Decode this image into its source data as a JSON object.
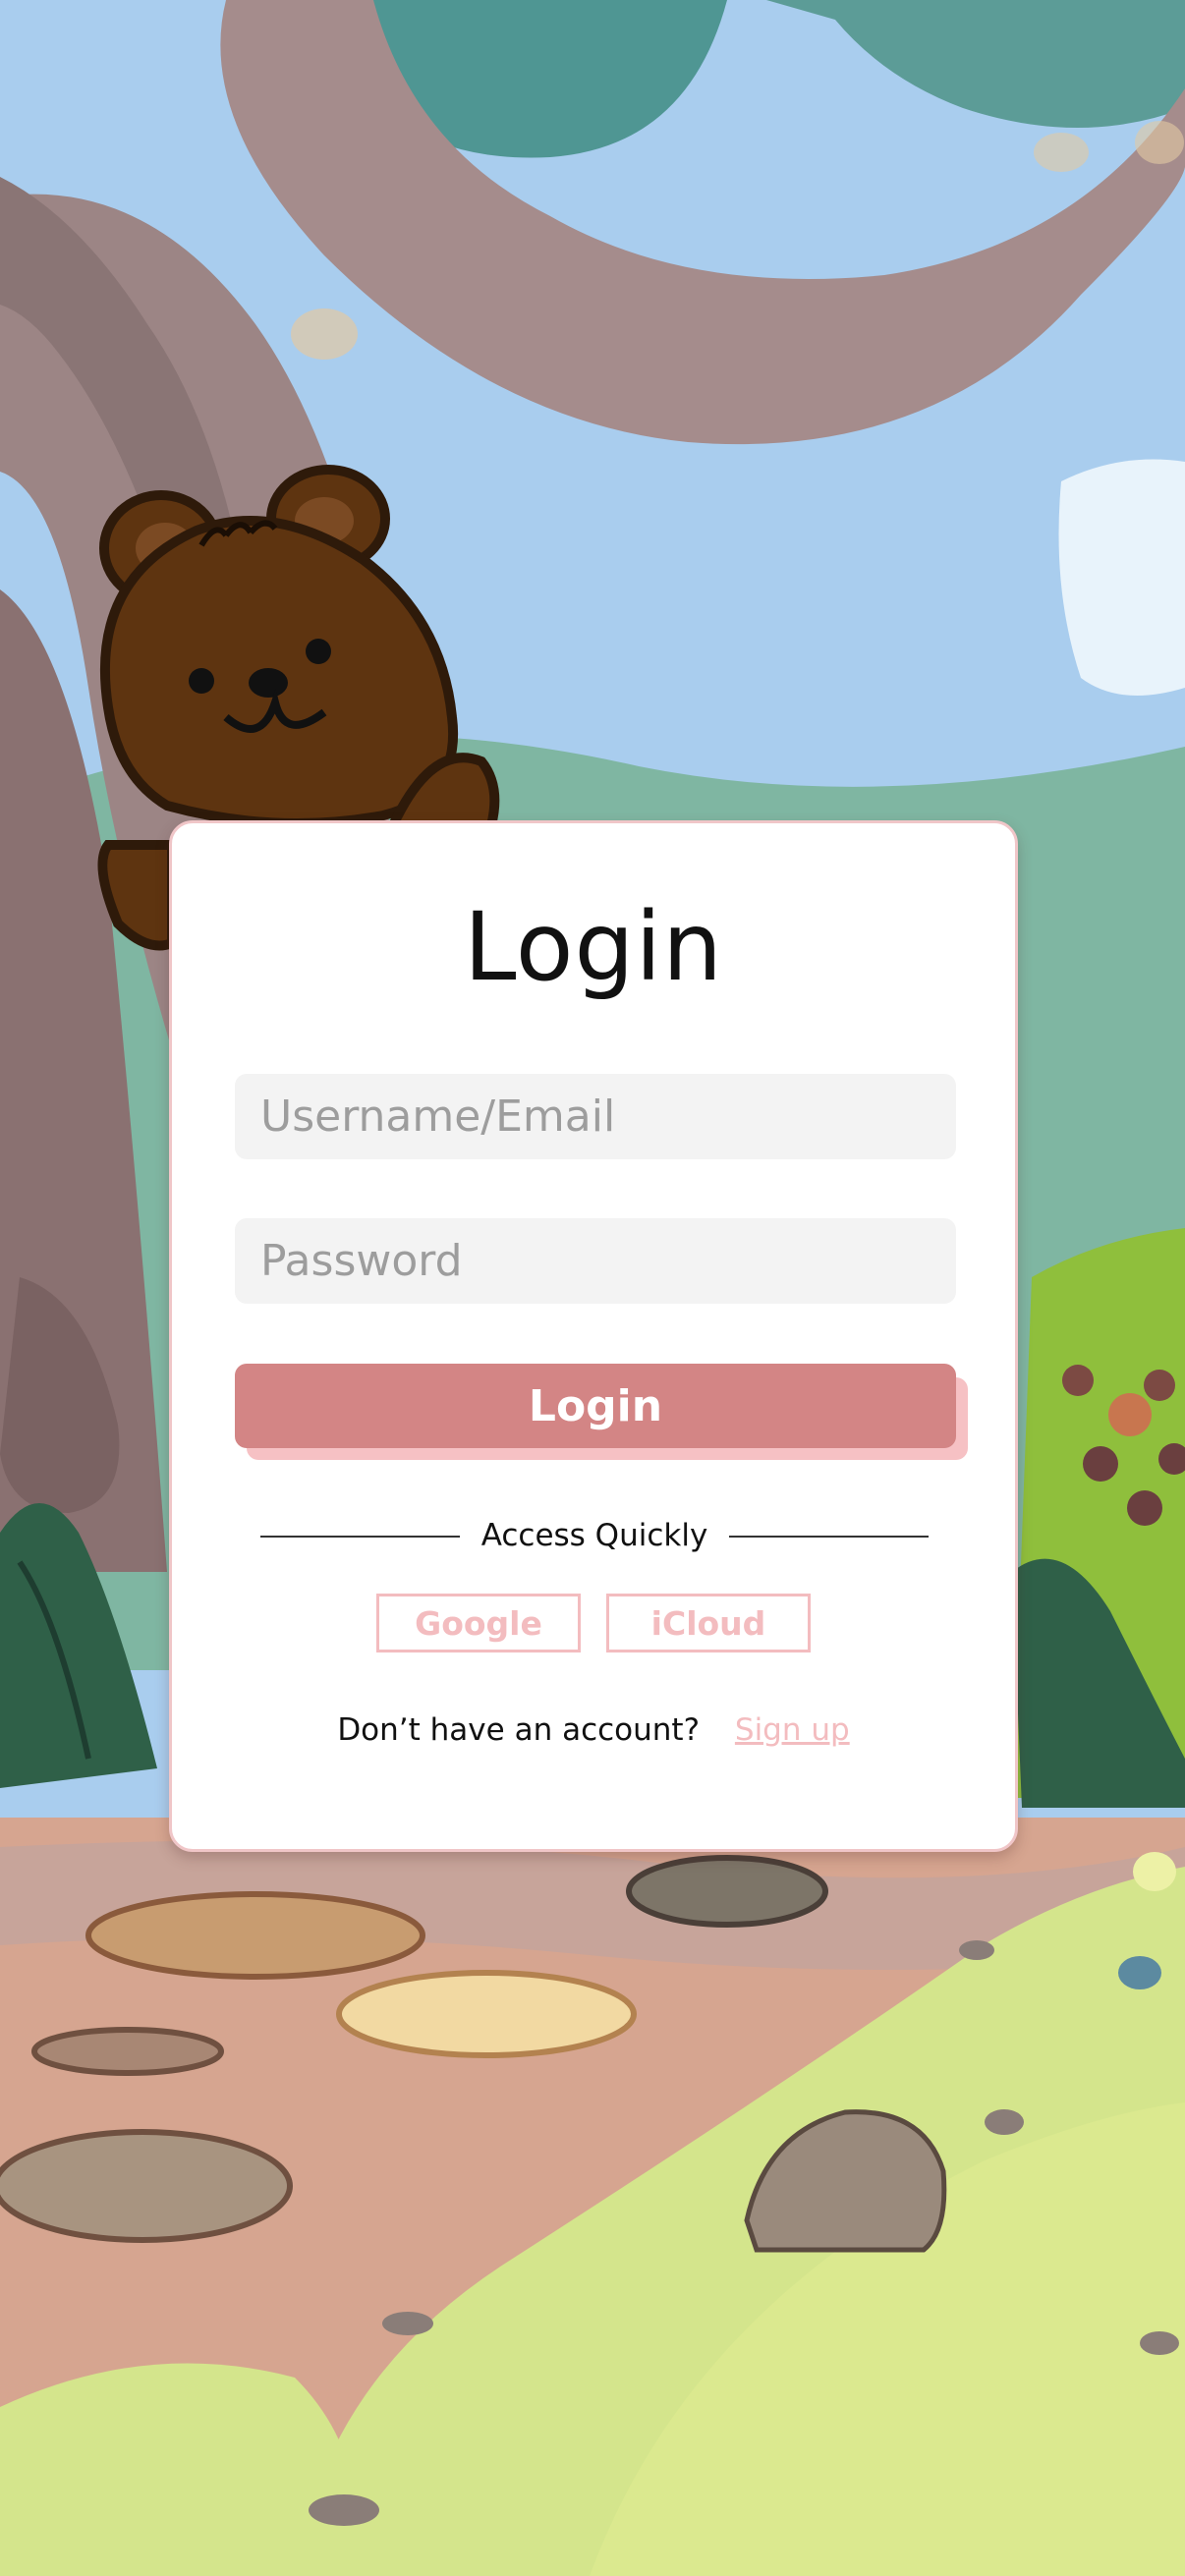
{
  "login_card": {
    "title": "Login",
    "username_placeholder": "Username/Email",
    "password_placeholder": "Password",
    "login_button_label": "Login",
    "divider_label": "Access Quickly",
    "quick_access": {
      "google_label": "Google",
      "icloud_label": "iCloud"
    },
    "signup_prompt": "Don’t have an account?",
    "signup_link_label": "Sign up"
  },
  "colors": {
    "accent": "#d38585",
    "accent_shadow": "#f6c1c4",
    "link_pink": "#f3bcbf",
    "card_border": "#f0c6c8",
    "field_bg": "#f3f3f3"
  },
  "illustration": {
    "icons": [
      "bear-mascot-icon",
      "tree-trunk",
      "bushes",
      "stepping-stones",
      "flowers"
    ]
  }
}
